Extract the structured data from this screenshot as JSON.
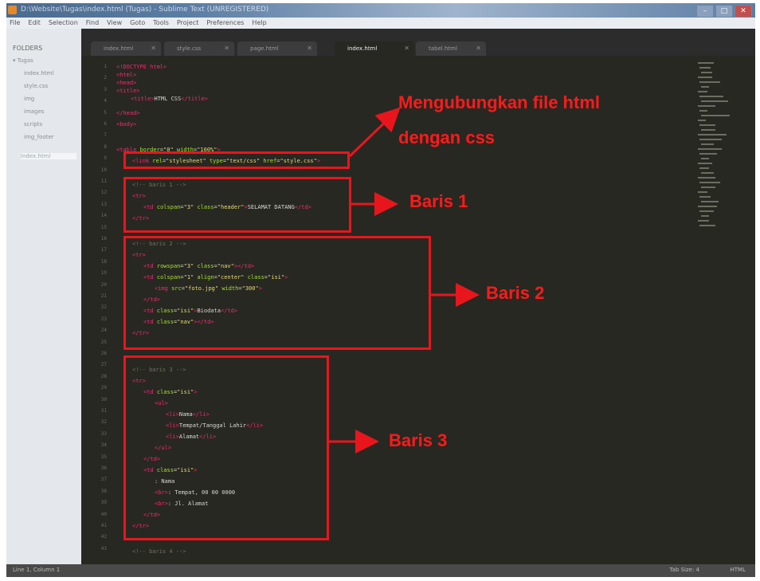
{
  "window": {
    "title": "D:\\Website\\Tugas\\index.html (Tugas) - Sublime Text (UNREGISTERED)",
    "buttons": [
      "–",
      "□",
      "✕"
    ]
  },
  "menu": [
    "File",
    "Edit",
    "Selection",
    "Find",
    "View",
    "Goto",
    "Tools",
    "Project",
    "Preferences",
    "Help"
  ],
  "sidebar": {
    "title": "FOLDERS",
    "items": [
      "▾ Tugas",
      "index.html",
      "style.css",
      "img",
      "images",
      "scripts",
      "img_footer",
      "index.html"
    ]
  },
  "tabs": [
    "index.html",
    "style.css",
    "page.html",
    "index.html",
    "tabel.html"
  ],
  "editor": {
    "line_numbers": [
      "1",
      "2",
      "3",
      "4",
      "5",
      "6",
      "7",
      "8",
      "9",
      "10",
      "11",
      "12",
      "13",
      "14",
      "15",
      "16",
      "17",
      "18",
      "19",
      "20",
      "21",
      "22",
      "23",
      "24",
      "25",
      "26",
      "27",
      "28",
      "29",
      "30",
      "31",
      "32",
      "33",
      "34",
      "35",
      "36",
      "37",
      "38",
      "39",
      "40",
      "41",
      "42",
      "43"
    ]
  },
  "status": {
    "left": "Line 1, Column 1",
    "tab_size": "Tab Size: 4",
    "syntax": "HTML"
  },
  "annotations": {
    "link_label_1": "Mengubungkan file html",
    "link_label_2": "dengan css",
    "row1": "Baris 1",
    "row2": "Baris 2",
    "row3": "Baris 3"
  },
  "colors": {
    "annotation": "#e8161c",
    "editor_bg": "#272822",
    "tag": "#f92672",
    "attr": "#a6e22e",
    "string": "#e6db74"
  }
}
